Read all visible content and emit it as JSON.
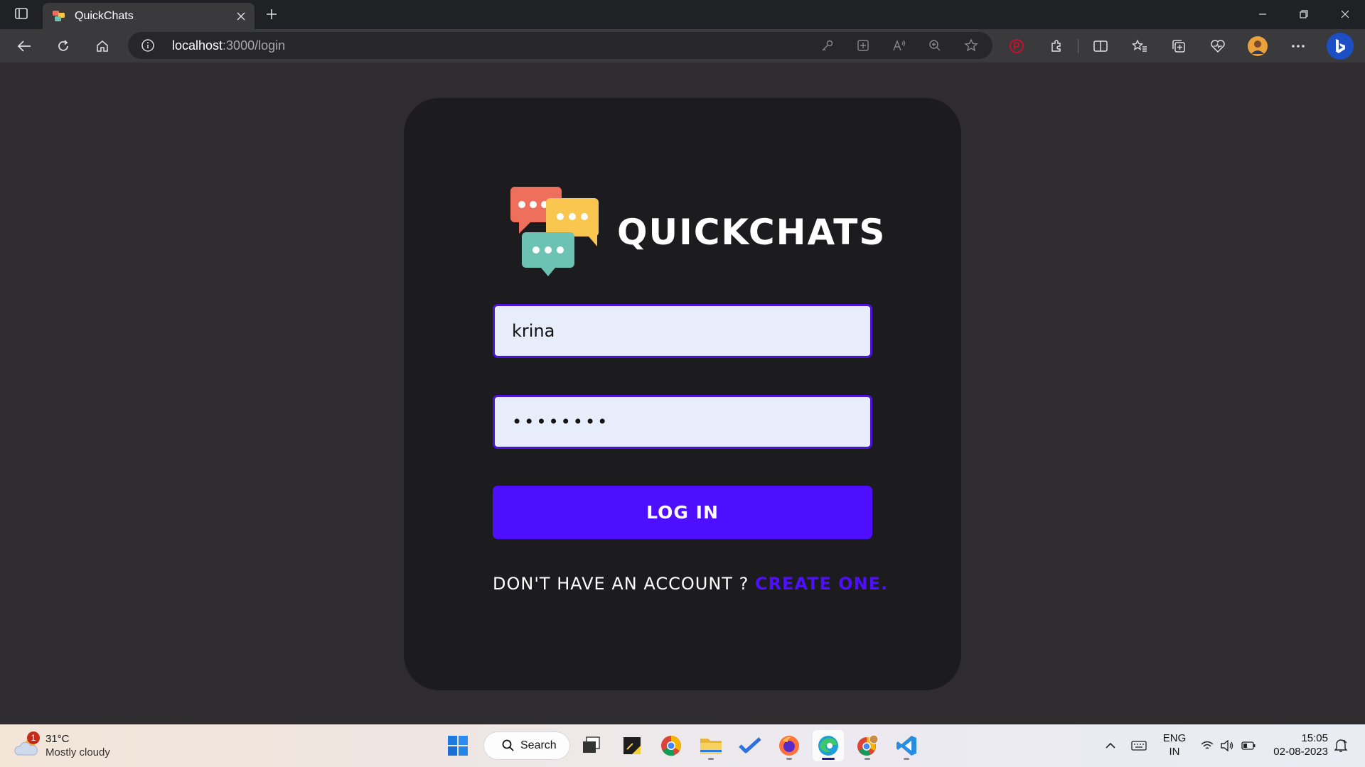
{
  "browser": {
    "tab_title": "QuickChats",
    "url_host": "localhost",
    "url_rest": ":3000/login"
  },
  "brand": {
    "name": "QUICKCHATS"
  },
  "login_form": {
    "username_value": "krina",
    "password_value": "krina123",
    "login_label": "LOG IN",
    "signup_prompt": "DON'T HAVE AN ACCOUNT ?",
    "signup_link": "CREATE ONE."
  },
  "taskbar": {
    "weather_badge": "1",
    "weather_temp": "31°C",
    "weather_desc": "Mostly cloudy",
    "search_label": "Search",
    "lang_line1": "ENG",
    "lang_line2": "IN",
    "time": "15:05",
    "date": "02-08-2023"
  },
  "colors": {
    "accent": "#4e0eff",
    "card_bg": "#1c1b1d",
    "page_bg": "#2f2c30",
    "input_bg": "#e8edfb"
  }
}
